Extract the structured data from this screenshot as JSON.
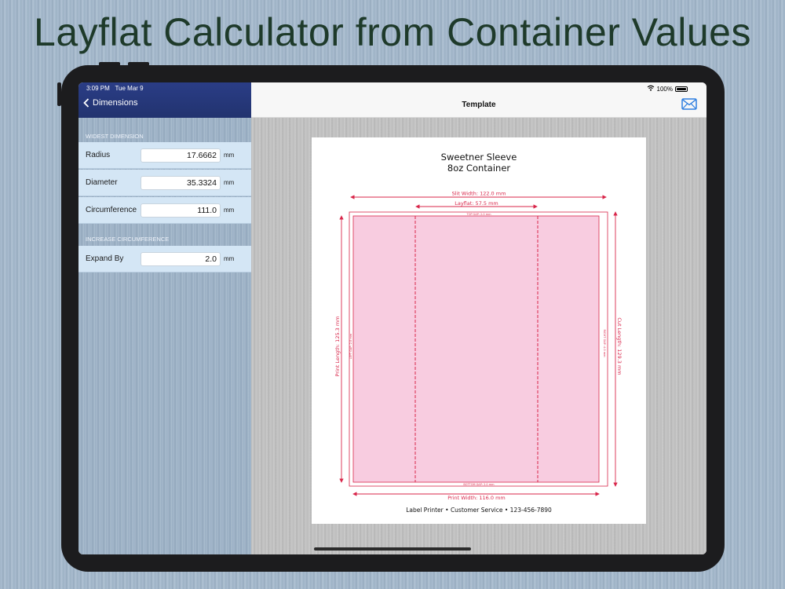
{
  "headline": "Layflat Calculator from Container Values",
  "status_bar": {
    "time": "3:09 PM",
    "date": "Tue Mar 9",
    "battery": "100%",
    "battery_level": 1.0
  },
  "sidebar": {
    "back_label": "Dimensions",
    "sections": [
      {
        "header": "WIDEST DIMENSION",
        "rows": [
          {
            "label": "Radius",
            "value": "17.6662",
            "unit": "mm"
          },
          {
            "label": "Diameter",
            "value": "35.3324",
            "unit": "mm"
          },
          {
            "label": "Circumference",
            "value": "111.0",
            "unit": "mm"
          }
        ]
      },
      {
        "header": "INCREASE CIRCUMFERENCE",
        "rows": [
          {
            "label": "Expand By",
            "value": "2.0",
            "unit": "mm"
          }
        ]
      }
    ]
  },
  "detail": {
    "title": "Template"
  },
  "template": {
    "title_line1": "Sweetner Sleeve",
    "title_line2": "8oz Container",
    "slit_width": "Slit Width: 122.0 mm",
    "layflat": "Layflat: 57.5 mm",
    "top_gap": "TOP GAP: 2.0 mm",
    "bottom_gap": "BOTTOM GAP: 2.0 mm",
    "left_gap": "LEFT GAP: 2.0 mm",
    "right_gap": "RIGHT GAP: 4.0 mm",
    "print_length": "Print Length: 125.3 mm",
    "cut_length": "Cut Length: 129.3 mm",
    "print_width": "Print Width: 116.0 mm",
    "footer": "Label Printer • Customer Service • 123-456-7890"
  },
  "colors": {
    "nav_blue": "#2a3d86",
    "row_blue": "#d4e6f5",
    "print_pink": "#f8cce0",
    "dim_red": "#d8264a",
    "mail_blue": "#2f7fe0",
    "headline_green": "#1e3a2a"
  }
}
